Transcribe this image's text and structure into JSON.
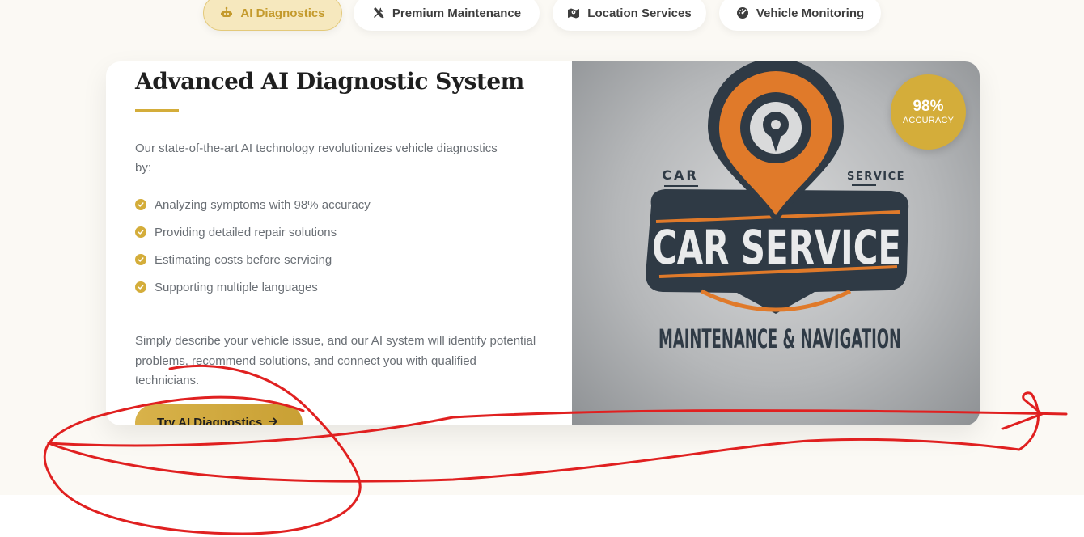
{
  "tabs": [
    {
      "label": "AI Diagnostics",
      "icon": "robot-icon",
      "active": true
    },
    {
      "label": "Premium Maintenance",
      "icon": "tools-icon",
      "active": false
    },
    {
      "label": "Location Services",
      "icon": "map-icon",
      "active": false
    },
    {
      "label": "Vehicle Monitoring",
      "icon": "gauge-icon",
      "active": false
    }
  ],
  "feature_panel": {
    "title": "Advanced AI Diagnostic System",
    "intro": "Our state-of-the-art AI technology revolutionizes vehicle diagnostics by:",
    "features": [
      "Analyzing symptoms with 98% accuracy",
      "Providing detailed repair solutions",
      "Estimating costs before servicing",
      "Supporting multiple languages"
    ],
    "description": "Simply describe your vehicle issue, and our AI system will identify potential problems, recommend solutions, and connect you with qualified technicians.",
    "cta_label": "Try AI Diagnostics",
    "cta_icon": "arrow-right-icon"
  },
  "image": {
    "badge_value": "98%",
    "badge_label": "ACCURACY",
    "logo_small_left": "CAR",
    "logo_small_right": "SERVICE",
    "logo_main": "CAR SERVICE",
    "logo_sub": "MAINTENANCE & NAVIGATION"
  },
  "colors": {
    "accent_gold": "#d4ad3a",
    "annotation_red": "#e02020",
    "logo_orange": "#e07a2a",
    "logo_navy": "#2f3a45"
  }
}
